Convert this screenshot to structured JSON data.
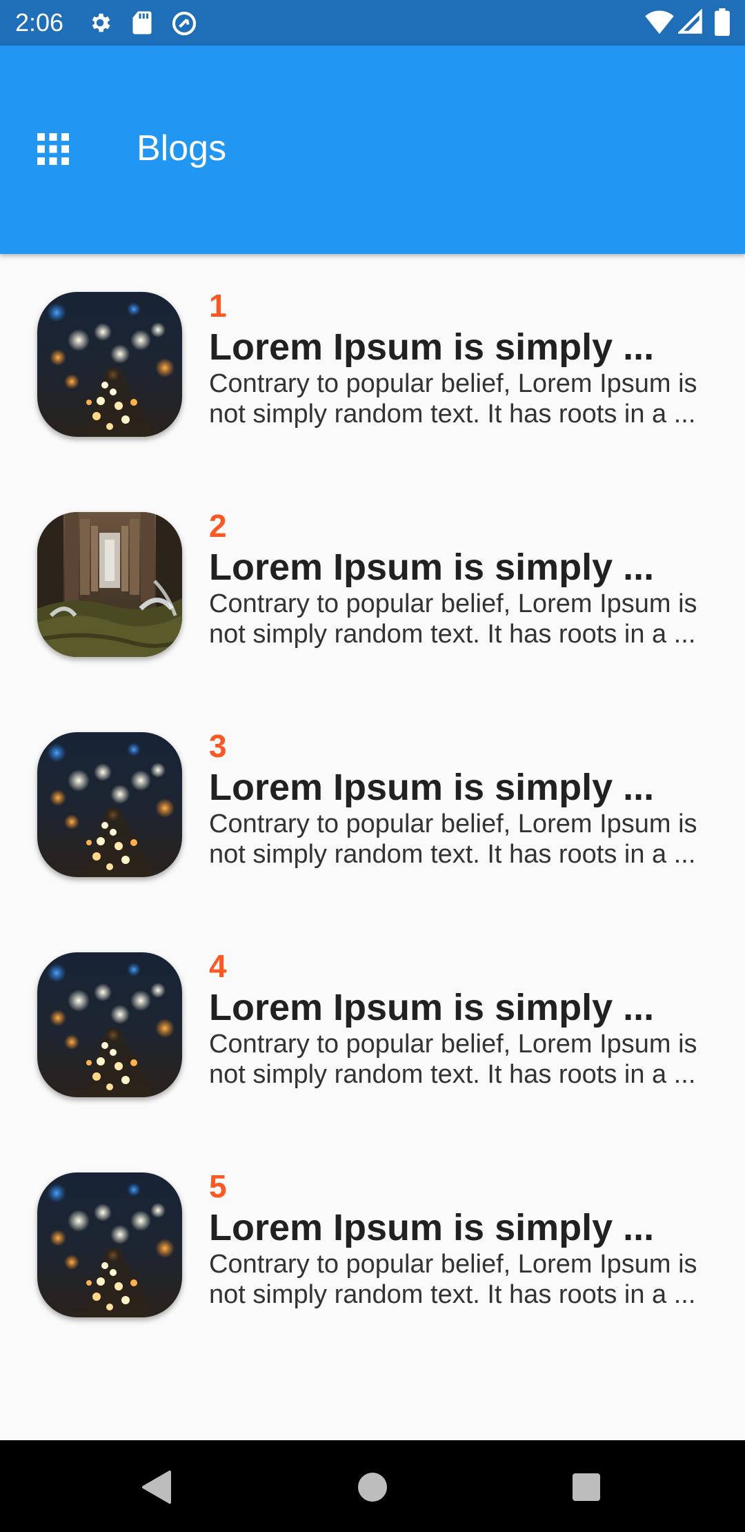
{
  "status_bar": {
    "time": "2:06",
    "left_icons": [
      "settings-icon",
      "sd-card-icon",
      "sync-icon"
    ],
    "right_icons": [
      "wifi-icon",
      "cell-signal-icon",
      "battery-icon"
    ]
  },
  "app_bar": {
    "title": "Blogs",
    "menu_icon": "apps-grid-icon",
    "color": "#2196f3"
  },
  "blogs": [
    {
      "number": "1",
      "title": "Lorem Ipsum is simply ...",
      "body_line1": "Contrary to popular belief, Lorem Ipsum is",
      "body_line2": "not simply random text. It has roots in a ...",
      "image": "city-lights-bokeh"
    },
    {
      "number": "2",
      "title": "Lorem Ipsum is simply ...",
      "body_line1": "Contrary to popular belief, Lorem Ipsum is",
      "body_line2": "not simply random text. It has roots in a ...",
      "image": "pier-waves"
    },
    {
      "number": "3",
      "title": "Lorem Ipsum is simply ...",
      "body_line1": "Contrary to popular belief, Lorem Ipsum is",
      "body_line2": "not simply random text. It has roots in a ...",
      "image": "city-lights-bokeh"
    },
    {
      "number": "4",
      "title": "Lorem Ipsum is simply ...",
      "body_line1": "Contrary to popular belief, Lorem Ipsum is",
      "body_line2": "not simply random text. It has roots in a ...",
      "image": "city-lights-bokeh"
    },
    {
      "number": "5",
      "title": "Lorem Ipsum is simply ...",
      "body_line1": "Contrary to popular belief, Lorem Ipsum is",
      "body_line2": "not simply random text. It has roots in a ...",
      "image": "city-lights-bokeh"
    }
  ],
  "colors": {
    "accent_number": "#ff5722",
    "status_bar": "#1e6fb7",
    "background": "#fafafa"
  },
  "nav_bar": {
    "buttons": [
      "back-icon",
      "home-icon",
      "recents-icon"
    ]
  }
}
